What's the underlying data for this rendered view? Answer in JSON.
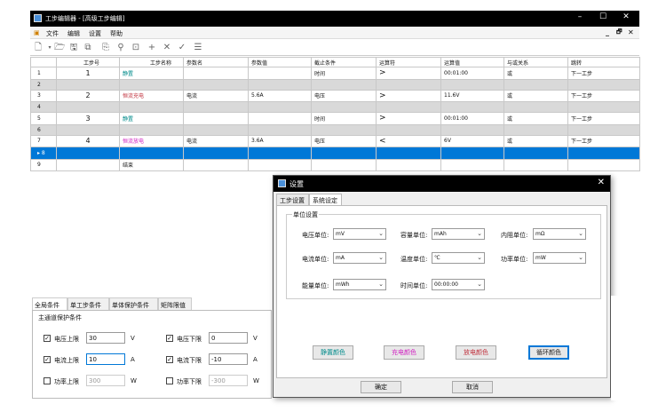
{
  "window": {
    "title": "工步编辑器 - [高级工步编辑]",
    "min": "–",
    "max": "☐",
    "close": "✕"
  },
  "menu": {
    "items": [
      "文件",
      "编辑",
      "设置",
      "帮助"
    ],
    "right_min": "_",
    "right_restore": "🗗",
    "right_close": "✕"
  },
  "toolbar": {
    "icons": [
      "new-file-icon",
      "open-folder-icon",
      "save-icon",
      "save-all-icon",
      "copy-icon",
      "pin-icon",
      "insert-icon",
      "add-icon",
      "delete-icon",
      "check-icon",
      "list-icon"
    ]
  },
  "grid": {
    "columns": [
      "",
      "工步号",
      "工步名称",
      "参数名",
      "参数值",
      "截止条件",
      "运算符",
      "运算值",
      "与或关系",
      "跳转"
    ],
    "rows": [
      {
        "rh": "1",
        "step": "1",
        "name": "静置",
        "kind": "rest",
        "param": "",
        "value": "",
        "cond": "时间",
        "op": ">",
        "opval": "00:01:00",
        "logic": "或",
        "jump": "下一工步"
      },
      {
        "rh": "2",
        "sep": true
      },
      {
        "rh": "3",
        "step": "2",
        "name": "恒流充电",
        "kind": "charge",
        "param": "电流",
        "value": "5.6A",
        "cond": "电压",
        "op": ">",
        "opval": "11.6V",
        "logic": "或",
        "jump": "下一工步"
      },
      {
        "rh": "4",
        "sep": true
      },
      {
        "rh": "5",
        "step": "3",
        "name": "静置",
        "kind": "rest",
        "param": "",
        "value": "",
        "cond": "时间",
        "op": ">",
        "opval": "00:01:00",
        "logic": "或",
        "jump": "下一工步"
      },
      {
        "rh": "6",
        "sep": true
      },
      {
        "rh": "7",
        "step": "4",
        "name": "恒流放电",
        "kind": "dis",
        "param": "电流",
        "value": "3.6A",
        "cond": "电压",
        "op": "<",
        "opval": "6V",
        "logic": "或",
        "jump": "下一工步"
      },
      {
        "rh": "▸ 8",
        "selected": true
      },
      {
        "rh": "9",
        "step": "",
        "name": "结束",
        "kind": "end",
        "param": "",
        "value": "",
        "cond": "",
        "op": "",
        "opval": "",
        "logic": "",
        "jump": ""
      }
    ]
  },
  "bottom": {
    "tabs": [
      "全局条件",
      "单工步条件",
      "单体保护条件",
      "矩阵限值"
    ],
    "group_title": "主通道保护条件",
    "rows": [
      {
        "l_label": "电压上限",
        "l_val": "30",
        "l_unit": "V",
        "l_checked": true,
        "r_label": "电压下限",
        "r_val": "0",
        "r_unit": "V",
        "r_checked": true
      },
      {
        "l_label": "电流上限",
        "l_val": "10",
        "l_unit": "A",
        "l_checked": true,
        "r_label": "电流下限",
        "r_val": "-10",
        "r_unit": "A",
        "r_checked": true
      },
      {
        "l_label": "功率上限",
        "l_val": "300",
        "l_unit": "W",
        "l_checked": false,
        "r_label": "功率下限",
        "r_val": "-300",
        "r_unit": "W",
        "r_checked": false
      }
    ]
  },
  "dialog": {
    "title": "设置",
    "tabs": [
      "工步设置",
      "系统设定"
    ],
    "group_title": "单位设置",
    "units": {
      "voltage": {
        "label": "电压单位:",
        "value": "mV"
      },
      "capacity": {
        "label": "容量单位:",
        "value": "mAh"
      },
      "resistance": {
        "label": "内阻单位:",
        "value": "mΩ"
      },
      "current": {
        "label": "电流单位:",
        "value": "mA"
      },
      "temperature": {
        "label": "温度单位:",
        "value": "℃"
      },
      "power": {
        "label": "功率单位:",
        "value": "mW"
      },
      "energy": {
        "label": "能量单位:",
        "value": "mWh"
      },
      "time": {
        "label": "时间单位:",
        "value": "00:00:00"
      }
    },
    "color_buttons": [
      {
        "label": "静置颜色",
        "color": "#008b8b"
      },
      {
        "label": "充电颜色",
        "color": "#d020c0"
      },
      {
        "label": "放电颜色",
        "color": "#c0303c"
      },
      {
        "label": "循环颜色",
        "color": "#222222"
      }
    ],
    "ok": "确定",
    "cancel": "取消"
  }
}
